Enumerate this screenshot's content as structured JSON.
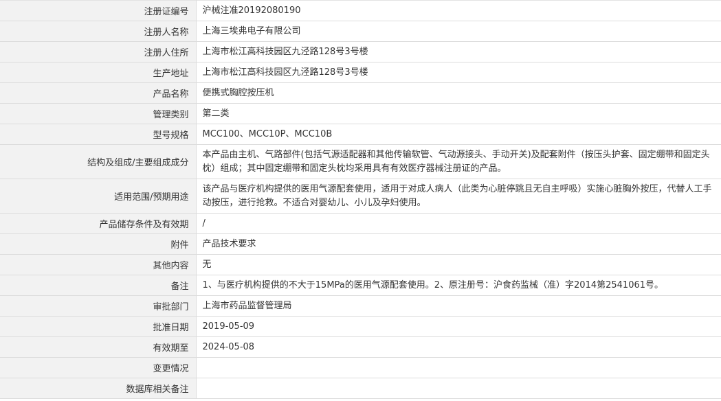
{
  "rows": [
    {
      "label": "注册证编号",
      "value": "沪械注准20192080190"
    },
    {
      "label": "注册人名称",
      "value": "上海三埃弗电子有限公司"
    },
    {
      "label": "注册人住所",
      "value": "上海市松江高科技园区九泾路128号3号楼"
    },
    {
      "label": "生产地址",
      "value": "上海市松江高科技园区九泾路128号3号楼"
    },
    {
      "label": "产品名称",
      "value": "便携式胸腔按压机"
    },
    {
      "label": "管理类别",
      "value": "第二类"
    },
    {
      "label": "型号规格",
      "value": "MCC100、MCC10P、MCC10B"
    },
    {
      "label": "结构及组成/主要组成成分",
      "value": "本产品由主机、气路部件(包括气源适配器和其他传输软管、气动源接头、手动开关)及配套附件（按压头护套、固定绷带和固定头枕）组成；其中固定绷带和固定头枕均采用具有有效医疗器械注册证的产品。"
    },
    {
      "label": "适用范围/预期用途",
      "value": "该产品与医疗机构提供的医用气源配套使用，适用于对成人病人（此类为心脏停跳且无自主呼吸）实施心脏胸外按压，代替人工手动按压，进行抢救。不适合对婴幼儿、小儿及孕妇使用。"
    },
    {
      "label": "产品储存条件及有效期",
      "value": "/"
    },
    {
      "label": "附件",
      "value": "产品技术要求"
    },
    {
      "label": "其他内容",
      "value": "无"
    },
    {
      "label": "备注",
      "value": "1、与医疗机构提供的不大于15MPa的医用气源配套使用。2、原注册号：沪食药监械（准）字2014第2541061号。"
    },
    {
      "label": "审批部门",
      "value": "上海市药品监督管理局"
    },
    {
      "label": "批准日期",
      "value": "2019-05-09"
    },
    {
      "label": "有效期至",
      "value": "2024-05-08"
    },
    {
      "label": "变更情况",
      "value": ""
    },
    {
      "label": "数据库相关备注",
      "value": ""
    }
  ]
}
